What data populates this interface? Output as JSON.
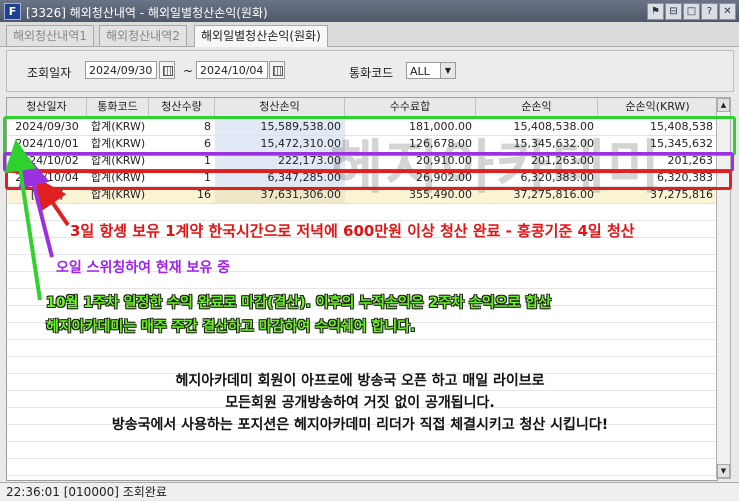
{
  "window": {
    "title": "[3326] 해외청산내역 - 해외일별청산손익(원화)",
    "app_icon": "F",
    "controls": [
      "minimize-to-tray-icon",
      "restore-icon",
      "maximize-icon",
      "help-icon",
      "close-icon"
    ],
    "control_glyphs": [
      "⚑",
      "⊟",
      "□",
      "?",
      "✕"
    ]
  },
  "tabs": [
    {
      "label": "해외청산내역1",
      "active": false
    },
    {
      "label": "해외청산내역2",
      "active": false
    },
    {
      "label": "해외일별청산손익(원화)",
      "active": true
    }
  ],
  "filter": {
    "date_label": "조회일자",
    "date_from": "2024/09/30",
    "date_sep": "~",
    "date_to": "2024/10/04",
    "currency_label": "통화코드",
    "currency_value": "ALL"
  },
  "table": {
    "columns": [
      "청산일자",
      "통화코드",
      "청산수량",
      "청산손익",
      "수수료합",
      "순손익",
      "순손익(KRW)"
    ],
    "rows": [
      {
        "date": "2024/09/30",
        "currency": "합계(KRW)",
        "qty": "8",
        "pl": "15,589,538.00",
        "fee": "181,000.00",
        "net": "15,408,538.00",
        "net_krw": "15,408,538"
      },
      {
        "date": "2024/10/01",
        "currency": "합계(KRW)",
        "qty": "6",
        "pl": "15,472,310.00",
        "fee": "126,678.00",
        "net": "15,345,632.00",
        "net_krw": "15,345,632"
      },
      {
        "date": "2024/10/02",
        "currency": "합계(KRW)",
        "qty": "1",
        "pl": "222,173.00",
        "fee": "20,910.00",
        "net": "201,263.00",
        "net_krw": "201,263"
      },
      {
        "date": "2024/10/04",
        "currency": "합계(KRW)",
        "qty": "1",
        "pl": "6,347,285.00",
        "fee": "26,902.00",
        "net": "6,320,383.00",
        "net_krw": "6,320,383"
      }
    ],
    "total": {
      "date": "[합 계]",
      "currency": "합계(KRW)",
      "qty": "16",
      "pl": "37,631,306.00",
      "fee": "355,490.00",
      "net": "37,275,816.00",
      "net_krw": "37,275,816"
    }
  },
  "status": {
    "time": "22:36:01",
    "code": "[010000]",
    "message": "조회완료"
  },
  "overlay": {
    "watermark": "헤지아카데미",
    "red_note": "3일 항셍 보유 1계약 한국시간으로 저녁에 600만원 이상 청산 완료 - 홍콩기준 4일 청산",
    "purple_note": "오일 스위칭하여 현재 보유 중",
    "green_note_1": "10월 1주차 일정한 수익 완료로 마감(결산). 이후의 누적손익은 2주차 손익으로 합산",
    "green_note_2": "헤지아카데미는 매주 주간 결산하고 마감하여 수익쉐어 합니다.",
    "black_note_1": "헤지아카데미 회원이 아프로에 방송국 오픈 하고 매일 라이브로",
    "black_note_2": "모든회원 공개방송하여 거짓 없이 공개됩니다.",
    "black_note_3": "방송국에서 사용하는 포지션은 헤지아카데미 리더가 직접 체결시키고 청산 시킵니다!",
    "colors": {
      "green": "#2ed12e",
      "purple": "#9b30e0",
      "red": "#e02020"
    }
  }
}
